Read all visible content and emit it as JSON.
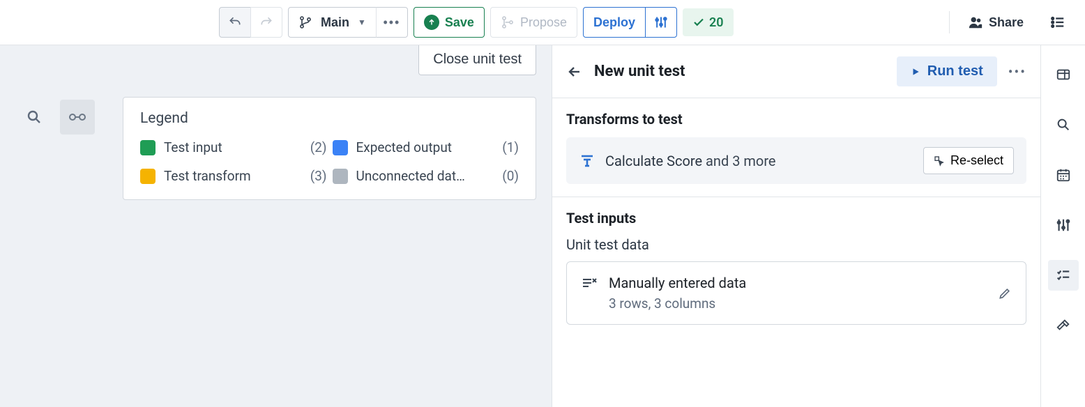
{
  "toolbar": {
    "branch_label": "Main",
    "save_label": "Save",
    "propose_label": "Propose",
    "deploy_label": "Deploy",
    "checks_count": "20",
    "share_label": "Share"
  },
  "canvas": {
    "close_label": "Close unit test",
    "legend_title": "Legend",
    "legend_items": [
      {
        "label": "Test input",
        "count": "(2)",
        "color": "#1f9d55"
      },
      {
        "label": "Expected output",
        "count": "(1)",
        "color": "#3b82f6"
      },
      {
        "label": "Test transform",
        "count": "(3)",
        "color": "#f5b301"
      },
      {
        "label": "Unconnected dat…",
        "count": "(0)",
        "color": "#aeb6bf"
      }
    ]
  },
  "panel": {
    "title": "New unit test",
    "run_label": "Run test",
    "transforms_heading": "Transforms to test",
    "transform_name": "Calculate Score",
    "transform_suffix": "and 3 more",
    "reselect_label": "Re-select",
    "inputs_heading": "Test inputs",
    "input_sub_label": "Unit test data",
    "input_card_title": "Manually entered data",
    "input_card_sub": "3 rows, 3 columns"
  }
}
